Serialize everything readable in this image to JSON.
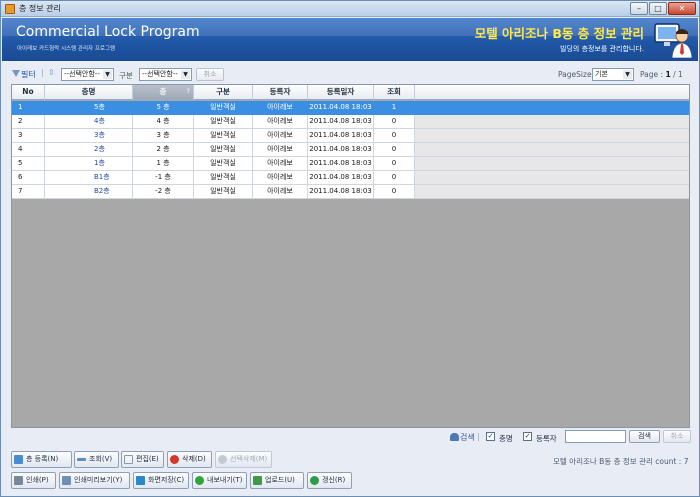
{
  "window": {
    "title": "층 정보 관리",
    "buttons": [
      "–",
      "□",
      "✕"
    ]
  },
  "banner": {
    "brand": "Commercial Lock Program",
    "brand_sub": "아이레보 카드형락 시스템 관리자 프로그램",
    "title": "모텔 아리조나 B동 층 정보 관리",
    "description": "빌딩의 층정보를 관리합니다."
  },
  "toolbar": {
    "filter_label": "필터",
    "select1_value": "--선택안함--",
    "category_label": "구분",
    "select2_value": "--선택안함--",
    "clear_label": "취소",
    "pagesize_label": "PageSize",
    "pagesize_value": "기본",
    "page_label": "Page :",
    "page_current": "1",
    "page_sep": "/",
    "page_total": "1"
  },
  "grid": {
    "columns": [
      "No",
      "층명",
      "층",
      "구분",
      "등록자",
      "등록일자",
      "조회"
    ],
    "sort_mark": "?",
    "rows": [
      {
        "no": "1",
        "name": "5층",
        "floor": "5 층",
        "type": "일반객실",
        "registrant": "아이레보",
        "date": "2011.04.08 18:03",
        "views": "1"
      },
      {
        "no": "2",
        "name": "4층",
        "floor": "4 층",
        "type": "일반객실",
        "registrant": "아이레보",
        "date": "2011.04.08 18:03",
        "views": "0"
      },
      {
        "no": "3",
        "name": "3층",
        "floor": "3 층",
        "type": "일반객실",
        "registrant": "아이레보",
        "date": "2011.04.08 18:03",
        "views": "0"
      },
      {
        "no": "4",
        "name": "2층",
        "floor": "2 층",
        "type": "일반객실",
        "registrant": "아이레보",
        "date": "2011.04.08 18:03",
        "views": "0"
      },
      {
        "no": "5",
        "name": "1층",
        "floor": "1 층",
        "type": "일반객실",
        "registrant": "아이레보",
        "date": "2011.04.08 18:03",
        "views": "0"
      },
      {
        "no": "6",
        "name": "B1층",
        "floor": "-1 층",
        "type": "일반객실",
        "registrant": "아이레보",
        "date": "2011.04.08 18:03",
        "views": "0"
      },
      {
        "no": "7",
        "name": "B2층",
        "floor": "-2 층",
        "type": "일반객실",
        "registrant": "아이레보",
        "date": "2011.04.08 18:03",
        "views": "0"
      }
    ],
    "selected_row": 1
  },
  "search": {
    "link_label": "검색",
    "check_floor_label": "층명",
    "check_registrant_label": "등록자",
    "check_mark": "✓",
    "input_value": "",
    "search_button": "검색",
    "cancel_button": "취소"
  },
  "actions": {
    "register": "층 등록(N)",
    "view": "조회(V)",
    "edit": "편집(E)",
    "delete": "삭제(D)",
    "delete_selected": "선택삭제(M)",
    "count_text": "모텔 아리조나 B동 층 정보 관리 count : 7"
  },
  "bottom": {
    "print": "인쇄(P)",
    "print_preview": "인쇄미리보기(Y)",
    "save_screen": "화면저장(C)",
    "export": "내보내기(T)",
    "upload": "업로드(U)",
    "refresh": "갱신(R)"
  },
  "colors": {
    "banner": "#1f56a6",
    "title_yellow": "#ffe84a",
    "selected_row": "#3b8fe3",
    "link_blue": "#2347a8"
  }
}
